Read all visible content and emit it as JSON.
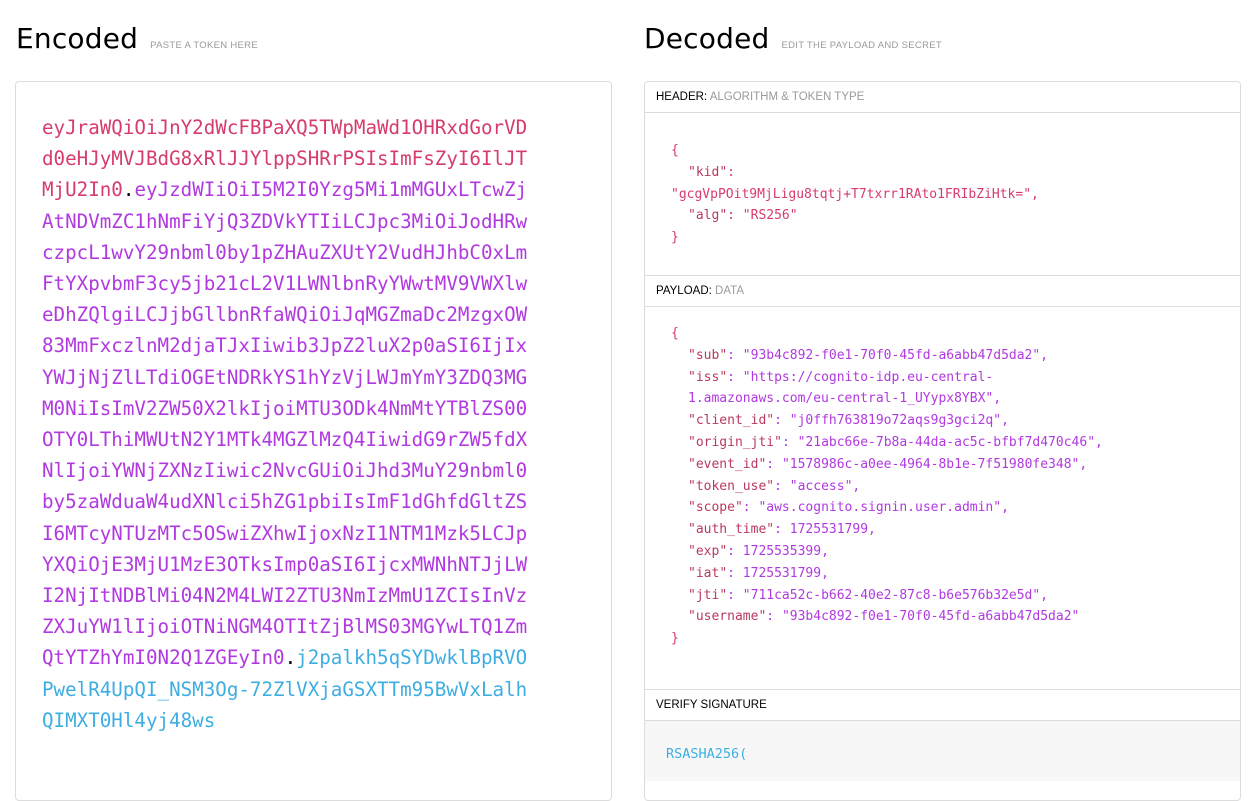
{
  "encoded": {
    "title": "Encoded",
    "subtitle": "PASTE A TOKEN HERE",
    "token_header": "eyJraWQiOiJnY2dWcFBPaXQ5TWpMaWd1OHRxdGorVDd0eHJyMVJBdG8xRlJJYlppSHRrPSIsImFsZyI6IlJTMjU2In0",
    "token_payload": "eyJzdWIiOiI5M2I0Yzg5Mi1mMGUxLTcwZjAtNDVmZC1hNmFiYjQ3ZDVkYTIiLCJpc3MiOiJodHRwczpcL1wvY29nbml0by1pZHAuZXUtY2VudHJhbC0xLmFtYXpvbmF3cy5jb21cL2V1LWNlbnRyYWwtMV9VWXlweDhZQlgiLCJjbGllbnRfaWQiOiJqMGZmaDc2MzgxOW83MmFxczlnM2djaTJxIiwib3JpZ2luX2p0aSI6IjIxYWJjNjZlLTdiOGEtNDRkYS1hYzVjLWJmYmY3ZDQ3MGM0NiIsImV2ZW50X2lkIjoiMTU3ODk4NmMtYTBlZS00OTY0LThiMWUtN2Y1MTk4MGZlMzQ4IiwidG9rZW5fdXNlIjoiYWNjZXNzIiwic2NvcGUiOiJhd3MuY29nbml0by5zaWduaW4udXNlci5hZG1pbiIsImF1dGhfdGltZSI6MTcyNTUzMTc5OSwiZXhwIjoxNzI1NTM1Mzk5LCJpYXQiOjE3MjU1MzE3OTksImp0aSI6IjcxMWNhNTJjLWI2NjItNDBlMi04N2M4LWI2ZTU3NmIzMmU1ZCIsInVzZXJuYW1lIjoiOTNiNGM4OTItZjBlMS03MGYwLTQ1ZmQtYTZhYmI0N2Q1ZGEyIn0",
    "token_signature": "j2palkh5qSYDwklBpRVOPwelR4UpQI_NSM3Og-72ZlVXjaGSXTTm95BwVxLalhQIMXT0Hl4yj48ws",
    "dot": "."
  },
  "decoded": {
    "title": "Decoded",
    "subtitle": "EDIT THE PAYLOAD AND SECRET",
    "header_section": {
      "label": "HEADER:",
      "sublabel": "ALGORITHM & TOKEN TYPE",
      "open_brace": "{",
      "close_brace": "}",
      "kid_key": "kid",
      "kid_value": "gcgVpPOit9MjLigu8tqtj+T7txrr1RAto1FRIbZiHtk=",
      "alg_key": "alg",
      "alg_value": "RS256"
    },
    "payload_section": {
      "label": "PAYLOAD:",
      "sublabel": "DATA",
      "open_brace": "{",
      "close_brace": "}",
      "fields": [
        {
          "key": "sub",
          "value": "93b4c892-f0e1-70f0-45fd-a6abb47d5da2",
          "quoted": true
        },
        {
          "key": "iss",
          "value": "https://cognito-idp.eu-central-1.amazonaws.com/eu-central-1_UYypx8YBX",
          "quoted": true
        },
        {
          "key": "client_id",
          "value": "j0ffh763819o72aqs9g3gci2q",
          "quoted": true
        },
        {
          "key": "origin_jti",
          "value": "21abc66e-7b8a-44da-ac5c-bfbf7d470c46",
          "quoted": true
        },
        {
          "key": "event_id",
          "value": "1578986c-a0ee-4964-8b1e-7f51980fe348",
          "quoted": true
        },
        {
          "key": "token_use",
          "value": "access",
          "quoted": true
        },
        {
          "key": "scope",
          "value": "aws.cognito.signin.user.admin",
          "quoted": true
        },
        {
          "key": "auth_time",
          "value": "1725531799",
          "quoted": false
        },
        {
          "key": "exp",
          "value": "1725535399",
          "quoted": false
        },
        {
          "key": "iat",
          "value": "1725531799",
          "quoted": false
        },
        {
          "key": "jti",
          "value": "711ca52c-b662-40e2-87c8-b6e576b32e5d",
          "quoted": true
        },
        {
          "key": "username",
          "value": "93b4c892-f0e1-70f0-45fd-a6abb47d5da2",
          "quoted": true
        }
      ]
    },
    "signature_section": {
      "label": "VERIFY SIGNATURE",
      "code": "RSASHA256("
    }
  },
  "colors": {
    "header": "#d63c6b",
    "payload": "#b139e0",
    "signature": "#3eaee2"
  }
}
